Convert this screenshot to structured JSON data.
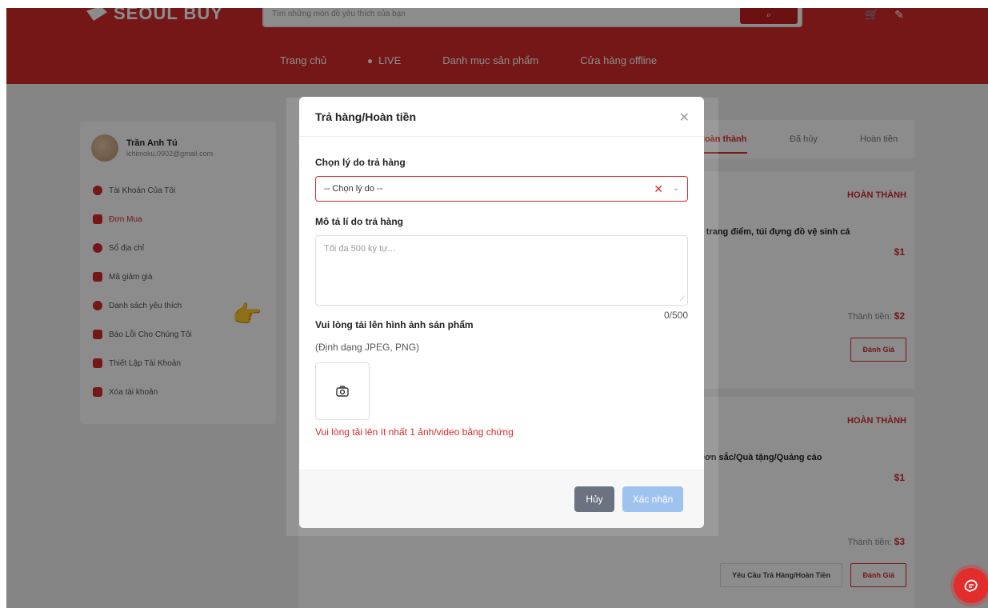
{
  "header": {
    "logo": "SEOUL BUY",
    "search_placeholder": "Tìm những món đồ yêu thích của bạn",
    "nav": [
      "Trang chủ",
      "LIVE",
      "Danh mục sản phẩm",
      "Cửa hàng offline"
    ]
  },
  "profile": {
    "name": "Trần Anh Tú",
    "email": "ichimoku.0902@gmail.com"
  },
  "sidebar": {
    "items": [
      {
        "label": "Tài Khoản Của Tôi",
        "icon": "user-icon"
      },
      {
        "label": "Đơn Mua",
        "icon": "order-icon",
        "active": true
      },
      {
        "label": "Sổ địa chỉ",
        "icon": "location-icon"
      },
      {
        "label": "Mã giảm giá",
        "icon": "voucher-icon"
      },
      {
        "label": "Danh sách yêu thích",
        "icon": "heart-icon"
      },
      {
        "label": "Báo Lỗi Cho Chúng Tôi",
        "icon": "warning-icon"
      },
      {
        "label": "Thiết Lập Tài Khoản",
        "icon": "settings-icon"
      },
      {
        "label": "Xóa tài khoản",
        "icon": "trash-icon"
      }
    ]
  },
  "tabs": [
    "Hoàn thành",
    "Đã hủy",
    "Hoàn tiền"
  ],
  "orders": [
    {
      "status": "HOÀN THÀNH",
      "desc": "ộ trang điểm, túi đựng đồ vệ sinh cá",
      "price": "$1",
      "total_label": "Thành tiền:",
      "total": "$2",
      "btn_rate": "Đánh Giá"
    },
    {
      "status": "HOÀN THÀNH",
      "desc": "Đơn sắc/Quà tặng/Quảng cáo",
      "price": "$1",
      "total_label": "Thành tiền:",
      "total": "$3",
      "btn_return": "Yêu Cầu Trả Hàng/Hoàn Tiền",
      "btn_rate": "Đánh Giá"
    }
  ],
  "modal": {
    "title": "Trả hàng/Hoàn tiền",
    "reason_label": "Chọn lý do trả hàng",
    "reason_value": "-- Chọn lý do --",
    "desc_label": "Mô tả lí do trả hàng",
    "desc_placeholder": "Tối đa 500 ký tự...",
    "counter": "0/500",
    "upload_label": "Vui lòng tải lên hình ảnh sản phẩm",
    "upload_hint": "(Định dạng JPEG, PNG)",
    "error": "Vui lòng tải lên ít nhất 1 ảnh/video bằng chứng",
    "cancel": "Hủy",
    "confirm": "Xác nhận"
  }
}
